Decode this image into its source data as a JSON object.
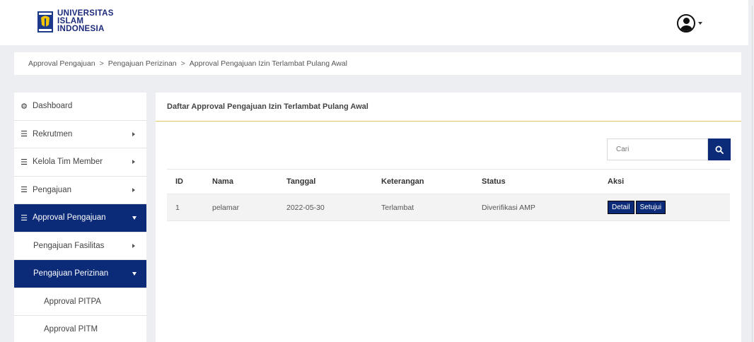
{
  "header": {
    "logo_lines": [
      "UNIVERSITAS",
      "ISLAM",
      "INDONESIA"
    ]
  },
  "breadcrumb": [
    "Approval Pengajuan",
    "Pengajuan Perizinan",
    "Approval Pengajuan Izin Terlambat Pulang Awal"
  ],
  "breadcrumb_sep": ">",
  "sidebar": {
    "items": [
      {
        "label": "Dashboard",
        "icon": "dashboard-icon"
      },
      {
        "label": "Rekrutmen",
        "icon": "list-icon"
      },
      {
        "label": "Kelola Tim Member",
        "icon": "list-icon"
      },
      {
        "label": "Pengajuan",
        "icon": "list-icon"
      },
      {
        "label": "Approval Pengajuan",
        "icon": "list-icon"
      },
      {
        "label": "Pengajuan Fasilitas"
      },
      {
        "label": "Pengajuan Perizinan"
      },
      {
        "label": "Approval PITPA"
      },
      {
        "label": "Approval PITM"
      }
    ]
  },
  "panel": {
    "title": "Daftar Approval Pengajuan Izin Terlambat Pulang Awal",
    "search_placeholder": "Cari",
    "columns": [
      "ID",
      "Nama",
      "Tanggal",
      "Keterangan",
      "Status",
      "Aksi"
    ],
    "rows": [
      {
        "id": "1",
        "nama": "pelamar",
        "tanggal": "2022-05-30",
        "keterangan": "Terlambat",
        "status": "Diverifikasi AMP",
        "actions": [
          "Detail",
          "Setujui"
        ]
      }
    ]
  },
  "colors": {
    "primary": "#0b2a78",
    "accent_line": "#e3c766"
  }
}
